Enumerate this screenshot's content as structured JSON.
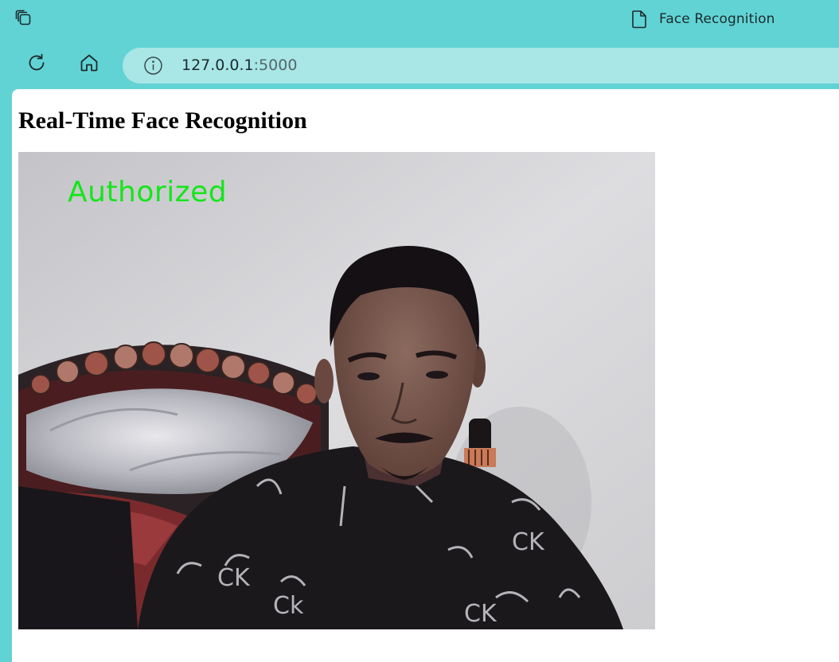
{
  "browser": {
    "tab_title": "Face Recognition",
    "url_host": "127.0.0.1",
    "url_port": ":5000"
  },
  "page": {
    "heading": "Real-Time Face Recognition",
    "video_overlay_label": "Authorized",
    "overlay_color": "#14e61b"
  },
  "icons": [
    "tab-actions-icon",
    "document-icon",
    "reload-icon",
    "home-icon",
    "info-icon"
  ]
}
